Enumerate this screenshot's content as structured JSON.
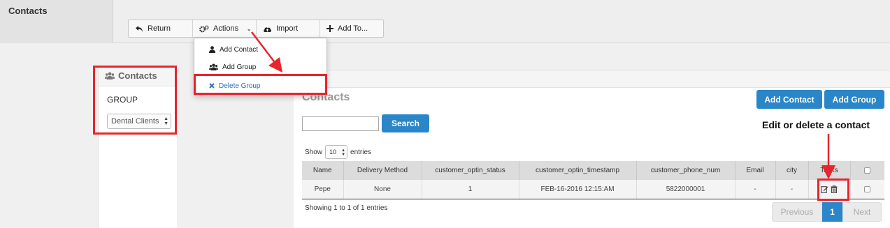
{
  "header": {
    "title": "Contacts"
  },
  "toolbar": {
    "return_label": "Return",
    "actions_label": "Actions",
    "import_label": "Import",
    "add_to_label": "Add To..."
  },
  "actions_menu": {
    "items": [
      "Add Contact",
      "Add Group",
      "Delete Group"
    ]
  },
  "sidebar": {
    "title": "Contacts",
    "group_label": "GROUP",
    "group_value": "Dental Clients"
  },
  "main": {
    "title": "Contacts",
    "add_contact_label": "Add Contact",
    "add_group_label": "Add Group",
    "search_label": "Search",
    "show_label": "Show",
    "entries_label": "entries",
    "page_length": "10",
    "columns": [
      "Name",
      "Delivery Method",
      "customer_optin_status",
      "customer_optin_timestamp",
      "customer_phone_num",
      "Email",
      "city",
      "Tasks"
    ],
    "rows": [
      [
        "Pepe",
        "None",
        "1",
        "FEB-16-2016 12:15:AM",
        "5822000001",
        "-",
        "-"
      ]
    ],
    "info": "Showing 1 to 1 of 1 entries",
    "pager": {
      "previous": "Previous",
      "current": "1",
      "next": "Next"
    }
  },
  "annotation": {
    "label": "Edit or delete a contact"
  },
  "colors": {
    "accent": "#2a86c8",
    "annotation_red": "#e8242c"
  }
}
